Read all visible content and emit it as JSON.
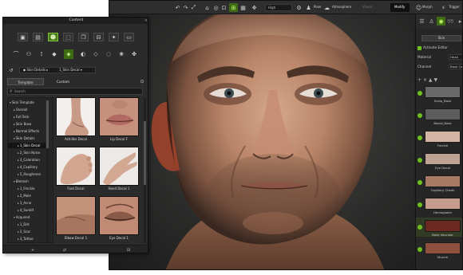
{
  "content_panel": {
    "title": "Content",
    "close_label": "×",
    "breadcrumb": [
      "Skin Details",
      "1_Skin Decal"
    ],
    "tabs": [
      "Template",
      "Custom"
    ],
    "search_placeholder": "Search",
    "tree": [
      {
        "label": "Skin Template",
        "indent": 0,
        "open": true
      },
      {
        "label": "Overall",
        "indent": 1
      },
      {
        "label": "Full Skin",
        "indent": 1
      },
      {
        "label": "Skin Base",
        "indent": 1
      },
      {
        "label": "Normal Effects",
        "indent": 1
      },
      {
        "label": "Skin Details",
        "indent": 1,
        "open": true
      },
      {
        "label": "1_Skin Decal",
        "indent": 2,
        "selected": true
      },
      {
        "label": "2_Skin Noise",
        "indent": 2
      },
      {
        "label": "3_Coloration",
        "indent": 2
      },
      {
        "label": "4_Capillary",
        "indent": 2
      },
      {
        "label": "5_Roughness",
        "indent": 2
      },
      {
        "label": "Blemish",
        "indent": 1,
        "open": true
      },
      {
        "label": "1_Freckle",
        "indent": 2
      },
      {
        "label": "2_Mole",
        "indent": 2
      },
      {
        "label": "3_Acne",
        "indent": 2
      },
      {
        "label": "4_Sunbit",
        "indent": 2
      },
      {
        "label": "Acquired",
        "indent": 1,
        "open": true
      },
      {
        "label": "1_Dirt",
        "indent": 2
      },
      {
        "label": "2_Scar",
        "indent": 2
      },
      {
        "label": "3_Tattoo",
        "indent": 2
      }
    ],
    "grid": [
      {
        "label": "Achilles Decal"
      },
      {
        "label": "Lip Decal F"
      },
      {
        "label": "Foot Decal"
      },
      {
        "label": "Hand Decal 1"
      },
      {
        "label": "Elbow Decal 1"
      },
      {
        "label": "Eye Decal 1"
      }
    ]
  },
  "toolbar": {
    "quality": "High",
    "pose": "Pose",
    "atmosphere": "Atmosphere",
    "visual": "Visual",
    "modify": "Modify",
    "morph": "Morph",
    "trigger": "Trigger"
  },
  "right_panel": {
    "skin_button": "Skin",
    "activate_editor": "Activate Editor",
    "material_label": "Material",
    "material_value": "Head",
    "channel_label": "Channel",
    "channel_value": "Base Color",
    "layers": [
      "Scalp_Base",
      "Beard_Base",
      "Freckle",
      "Eye Decal",
      "Capillary Cheek",
      "Hemoglobin",
      "Body Vascular",
      "Muscle"
    ]
  },
  "colors": {
    "accent": "#6fbf20",
    "panel": "#2b2b2b",
    "viewport": "#2a2a29"
  }
}
